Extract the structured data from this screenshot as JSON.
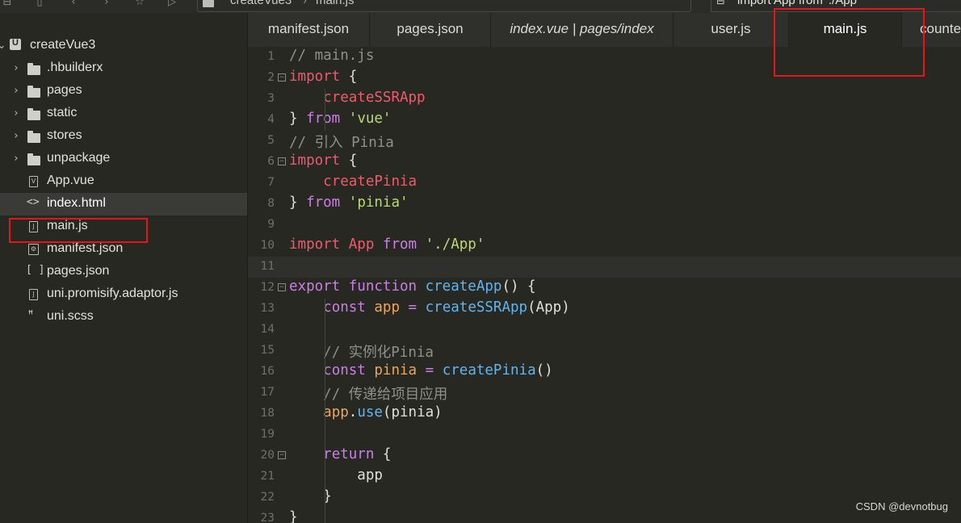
{
  "topbar": {
    "icons": [
      "collapse-icon",
      "doc-icon",
      "back-icon",
      "forward-icon",
      "star-icon",
      "run-icon"
    ],
    "breadcrumb": {
      "project": "createVue3",
      "file": "main.js",
      "separator": "›"
    },
    "search": {
      "value": "import App from './App'"
    }
  },
  "sidebar": {
    "project": "createVue3",
    "items": [
      {
        "label": ".hbuilderx",
        "type": "folder"
      },
      {
        "label": "pages",
        "type": "folder"
      },
      {
        "label": "static",
        "type": "folder"
      },
      {
        "label": "stores",
        "type": "folder"
      },
      {
        "label": "unpackage",
        "type": "folder"
      },
      {
        "label": "App.vue",
        "type": "vue"
      },
      {
        "label": "index.html",
        "type": "html",
        "selected": true
      },
      {
        "label": "main.js",
        "type": "js",
        "highlighted": true
      },
      {
        "label": "manifest.json",
        "type": "manifest"
      },
      {
        "label": "pages.json",
        "type": "json"
      },
      {
        "label": "uni.promisify.adaptor.js",
        "type": "js"
      },
      {
        "label": "uni.scss",
        "type": "scss"
      }
    ]
  },
  "tabs": [
    {
      "label": "manifest.json"
    },
    {
      "label": "pages.json"
    },
    {
      "label": "index.vue | pages/index",
      "italic": true
    },
    {
      "label": "user.js"
    },
    {
      "label": "main.js",
      "active": true
    },
    {
      "label": "counte"
    }
  ],
  "editor": {
    "current_line": 11,
    "lines": [
      {
        "n": "1",
        "tokens": [
          [
            "c",
            "// main.js"
          ]
        ]
      },
      {
        "n": "2",
        "fold": true,
        "tokens": [
          [
            "kwred",
            "import"
          ],
          [
            "p",
            " {"
          ]
        ]
      },
      {
        "n": "3",
        "tokens": [
          [
            "p",
            "    "
          ],
          [
            "id",
            "createSSRApp"
          ]
        ]
      },
      {
        "n": "4",
        "tokens": [
          [
            "p",
            "} "
          ],
          [
            "kw",
            "from"
          ],
          [
            "p",
            " "
          ],
          [
            "s",
            "'vue'"
          ]
        ]
      },
      {
        "n": "5",
        "tokens": [
          [
            "c",
            "// 引入 Pinia"
          ]
        ]
      },
      {
        "n": "6",
        "fold": true,
        "tokens": [
          [
            "kwred",
            "import"
          ],
          [
            "p",
            " {"
          ]
        ]
      },
      {
        "n": "7",
        "tokens": [
          [
            "p",
            "    "
          ],
          [
            "id",
            "createPinia"
          ]
        ]
      },
      {
        "n": "8",
        "tokens": [
          [
            "p",
            "} "
          ],
          [
            "kw",
            "from"
          ],
          [
            "p",
            " "
          ],
          [
            "s",
            "'pinia'"
          ]
        ]
      },
      {
        "n": "9",
        "tokens": []
      },
      {
        "n": "10",
        "tokens": [
          [
            "kwred",
            "import"
          ],
          [
            "p",
            " "
          ],
          [
            "id",
            "App"
          ],
          [
            "p",
            " "
          ],
          [
            "kw",
            "from"
          ],
          [
            "p",
            " "
          ],
          [
            "s",
            "'./App'"
          ]
        ]
      },
      {
        "n": "11",
        "tokens": []
      },
      {
        "n": "12",
        "fold": true,
        "tokens": [
          [
            "kw",
            "export"
          ],
          [
            "p",
            " "
          ],
          [
            "kw",
            "function"
          ],
          [
            "p",
            " "
          ],
          [
            "fn",
            "createApp"
          ],
          [
            "p",
            "() {"
          ]
        ]
      },
      {
        "n": "13",
        "tokens": [
          [
            "p",
            "    "
          ],
          [
            "kw",
            "const"
          ],
          [
            "p",
            " "
          ],
          [
            "v",
            "app"
          ],
          [
            "p",
            " "
          ],
          [
            "kw",
            "="
          ],
          [
            "p",
            " "
          ],
          [
            "fn",
            "createSSRApp"
          ],
          [
            "p",
            "(App)"
          ]
        ]
      },
      {
        "n": "14",
        "tokens": []
      },
      {
        "n": "15",
        "tokens": [
          [
            "p",
            "    "
          ],
          [
            "c",
            "// 实例化Pinia"
          ]
        ]
      },
      {
        "n": "16",
        "tokens": [
          [
            "p",
            "    "
          ],
          [
            "kw",
            "const"
          ],
          [
            "p",
            " "
          ],
          [
            "v",
            "pinia"
          ],
          [
            "p",
            " "
          ],
          [
            "kw",
            "="
          ],
          [
            "p",
            " "
          ],
          [
            "fn",
            "createPinia"
          ],
          [
            "p",
            "()"
          ]
        ]
      },
      {
        "n": "17",
        "tokens": [
          [
            "p",
            "    "
          ],
          [
            "c",
            "// 传递给项目应用"
          ]
        ]
      },
      {
        "n": "18",
        "tokens": [
          [
            "p",
            "    "
          ],
          [
            "v",
            "app"
          ],
          [
            "p",
            "."
          ],
          [
            "fn",
            "use"
          ],
          [
            "p",
            "(pinia)"
          ]
        ]
      },
      {
        "n": "19",
        "tokens": []
      },
      {
        "n": "20",
        "fold": true,
        "tokens": [
          [
            "p",
            "    "
          ],
          [
            "kw",
            "return"
          ],
          [
            "p",
            " {"
          ]
        ]
      },
      {
        "n": "21",
        "tokens": [
          [
            "p",
            "        app"
          ]
        ]
      },
      {
        "n": "22",
        "tokens": [
          [
            "p",
            "    }"
          ]
        ]
      },
      {
        "n": "23",
        "tokens": [
          [
            "p",
            "}"
          ]
        ]
      }
    ]
  },
  "colors": {
    "highlight_box": "#e4161b",
    "background": "#272822"
  },
  "watermark": "CSDN @devnotbug"
}
